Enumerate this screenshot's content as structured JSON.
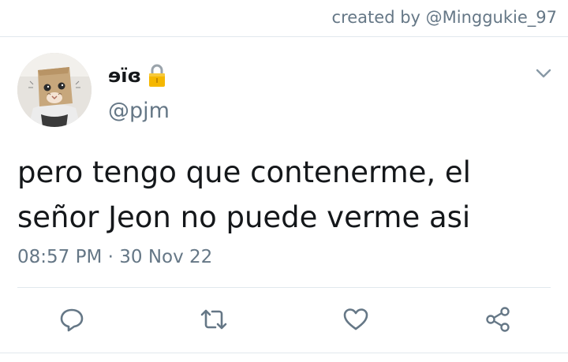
{
  "credit": "created by @Minggukie_97",
  "tweet": {
    "display_name": "ɘïɞ",
    "handle": "@pjm",
    "text_line1": "pero tengo que contenerme, el",
    "text_line2": "señor Jeon no puede verme asi",
    "timestamp": "08:57 PM · 30 Nov 22"
  },
  "icons": {
    "lock": "lock-icon",
    "chevron": "chevron-down-icon",
    "reply": "reply-icon",
    "retweet": "retweet-icon",
    "like": "heart-icon",
    "share": "share-icon"
  },
  "colors": {
    "secondary_text": "#657786",
    "primary_text": "#14171a",
    "divider": "#e1e8ed",
    "action_icon": "#1da1f2"
  }
}
